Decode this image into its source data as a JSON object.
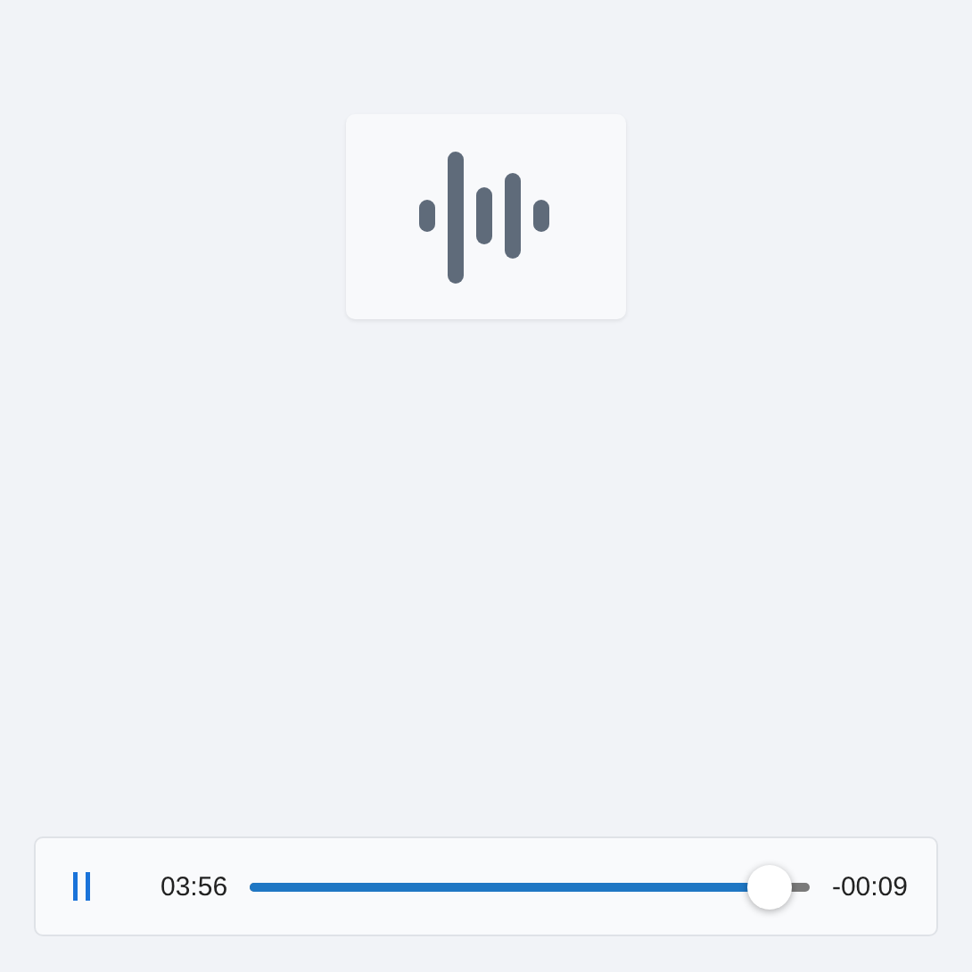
{
  "player": {
    "playing": true,
    "elapsed": "03:56",
    "remaining": "-00:09",
    "level": 0.93
  }
}
